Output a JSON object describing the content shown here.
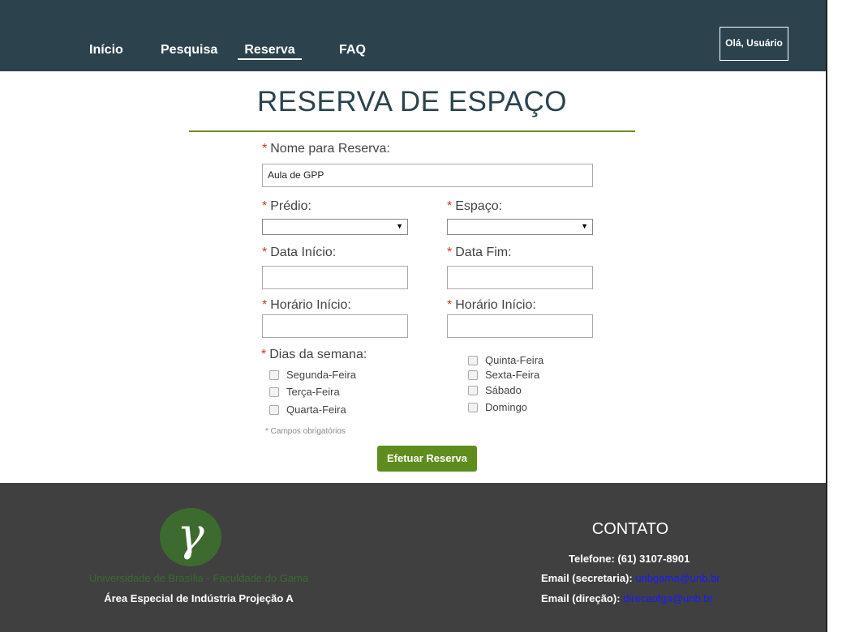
{
  "header": {
    "nav": [
      {
        "label": "Início"
      },
      {
        "label": "Pesquisa"
      },
      {
        "label": "Reserva"
      },
      {
        "label": "FAQ"
      }
    ],
    "user_label": "Olá, Usuário"
  },
  "page_title": "RESERVA DE ESPAÇO",
  "form": {
    "required_mark": "*",
    "name_label": "Nome para Reserva:",
    "name_value": "Aula de GPP",
    "building_label": "Prédio:",
    "space_label": "Espaço:",
    "start_date_label": "Data Início:",
    "end_date_label": "Data Fim:",
    "start_time_label": "Horário Início:",
    "end_time_label": "Horário Início:",
    "days_label": "Dias da semana:",
    "days_left": [
      "Segunda-Feira",
      "Terça-Feira",
      "Quarta-Feira"
    ],
    "days_right": [
      "Quinta-Feira",
      "Sexta-Feira",
      "Sábado",
      "Domingo"
    ],
    "required_note": "* Campos obrigatórios",
    "submit_label": "Efetuar Reserva",
    "select_arrow": "▼"
  },
  "footer": {
    "logo_glyph": "γ",
    "university": "Universidade de Brasília - Faculdade do Gama",
    "address": "Área Especial de Indústria Projeção A",
    "contact_title": "CONTATO",
    "phone": "Telefone: (61) 3107-8901",
    "email_secretary_label": "Email (secretaria):",
    "email_secretary": "unbgama@unb.br",
    "email_direction_label": "Email (direção):",
    "email_direction": "direcaofga@unb.br"
  },
  "colors": {
    "header_bg": "#2c434e",
    "accent_green": "#5e8d1e",
    "footer_bg": "#404040",
    "required_red": "#c0392b",
    "link_blue": "#1a1aff"
  }
}
